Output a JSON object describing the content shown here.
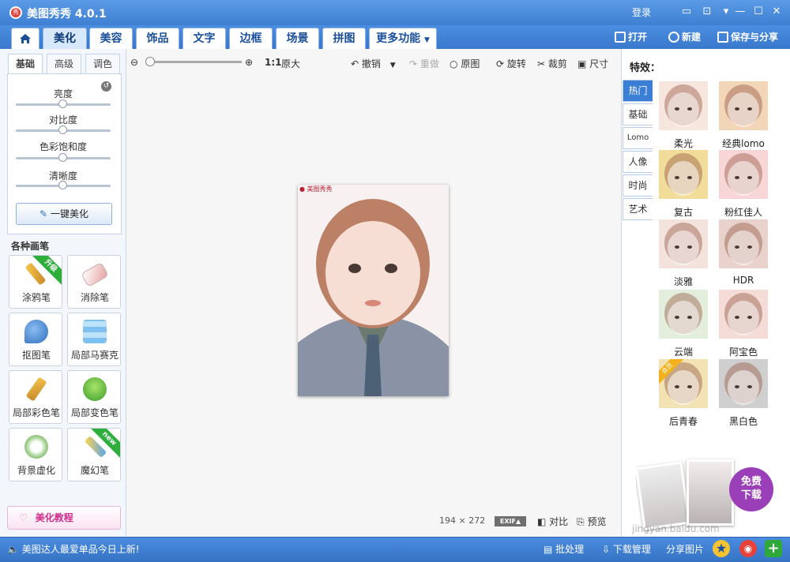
{
  "app": {
    "title": "美图秀秀 4.0.1",
    "logo_char": "秀",
    "login": "登录"
  },
  "nav": {
    "tabs": [
      {
        "label": "美化",
        "active": true
      },
      {
        "label": "美容"
      },
      {
        "label": "饰品"
      },
      {
        "label": "文字"
      },
      {
        "label": "边框"
      },
      {
        "label": "场景"
      },
      {
        "label": "拼图"
      },
      {
        "label": "更多功能"
      }
    ],
    "actions": {
      "open": "打开",
      "new": "新建",
      "save": "保存与分享"
    }
  },
  "left": {
    "subtabs": [
      "基础",
      "高级",
      "调色"
    ],
    "sliders": [
      {
        "label": "亮度",
        "value": 0.5
      },
      {
        "label": "对比度",
        "value": 0.5
      },
      {
        "label": "色彩饱和度",
        "value": 0.5
      },
      {
        "label": "清晰度",
        "value": 0.5
      }
    ],
    "one_click": "一键美化",
    "brush_section": "各种画笔",
    "tools": [
      {
        "label": "涂鸦笔",
        "badge": "升级"
      },
      {
        "label": "消除笔"
      },
      {
        "label": "抠图笔"
      },
      {
        "label": "局部马赛克"
      },
      {
        "label": "局部彩色笔"
      },
      {
        "label": "局部变色笔"
      },
      {
        "label": "背景虚化"
      },
      {
        "label": "魔幻笔",
        "badge": "new"
      }
    ],
    "tutorial": "美化教程"
  },
  "toolbar": {
    "zoom_ratio": "1:1",
    "original_size": "原大",
    "undo": "撤销",
    "redo": "重做",
    "original": "原图",
    "rotate": "旋转",
    "crop": "裁剪",
    "resize": "尺寸"
  },
  "canvas": {
    "watermark": "美图秀秀",
    "width": "194",
    "times": "×",
    "height": "272",
    "exif": "EXIF",
    "compare": "对比",
    "preview": "预览"
  },
  "effects": {
    "title": "特效：",
    "categories": [
      "热门",
      "基础",
      "Lomo",
      "人像",
      "时尚",
      "艺术"
    ],
    "items": [
      {
        "label": "柔光",
        "tint": "#f7e6de"
      },
      {
        "label": "经典lomo",
        "tint": "#f3d6b8"
      },
      {
        "label": "复古",
        "tint": "#f2dc9a"
      },
      {
        "label": "粉红佳人",
        "tint": "#f8d6d8"
      },
      {
        "label": "淡雅",
        "tint": "#f4e2dc"
      },
      {
        "label": "HDR",
        "tint": "#ead2cc"
      },
      {
        "label": "云端",
        "tint": "#e4eedc"
      },
      {
        "label": "阿宝色",
        "tint": "#f5dcd6"
      },
      {
        "label": "后青春",
        "tint": "#f3e3b4",
        "badge": "会员"
      },
      {
        "label": "黑白色",
        "tint": "#cfcfcf"
      }
    ],
    "ad": {
      "line1": "免费",
      "line2": "下载"
    }
  },
  "status": {
    "news": "美图达人最爱单品今日上新!",
    "batch": "批处理",
    "downloads": "下载管理",
    "share": "分享图片"
  },
  "watermark_site": "jingyan.baidu.com",
  "colors": {
    "accent": "#3a7ed6",
    "tool_badge": "#2fae3c"
  }
}
